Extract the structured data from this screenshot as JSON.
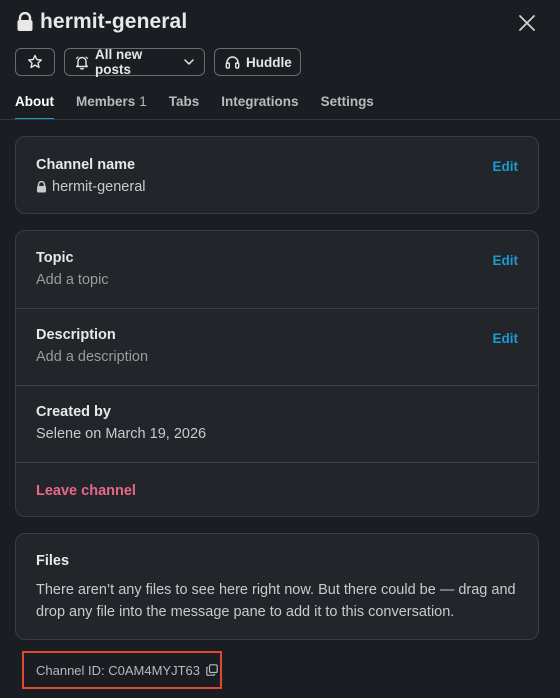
{
  "header": {
    "title": "hermit-general",
    "close_icon": "close-icon"
  },
  "actions": {
    "star_icon": "star-icon",
    "notifications_label": "All new posts",
    "huddle_label": "Huddle"
  },
  "tabs": [
    {
      "label": "About",
      "active": true
    },
    {
      "label": "Members",
      "count": "1"
    },
    {
      "label": "Tabs"
    },
    {
      "label": "Integrations"
    },
    {
      "label": "Settings"
    }
  ],
  "channel_name": {
    "label": "Channel name",
    "value": "hermit-general",
    "edit": "Edit"
  },
  "topic": {
    "label": "Topic",
    "placeholder": "Add a topic",
    "edit": "Edit"
  },
  "description": {
    "label": "Description",
    "placeholder": "Add a description",
    "edit": "Edit"
  },
  "created_by": {
    "label": "Created by",
    "value": "Selene on March 19, 2026"
  },
  "leave": {
    "label": "Leave channel"
  },
  "files": {
    "label": "Files",
    "text": "There aren’t any files to see here right now. But there could be — drag and drop any file into the message pane to add it to this conversation."
  },
  "channel_id": {
    "text": "Channel ID: C0AM4MYJT63"
  },
  "colors": {
    "accent": "#1d9bd1",
    "danger": "#e8688a",
    "highlight": "#e0492f",
    "background": "#1a1d21"
  }
}
